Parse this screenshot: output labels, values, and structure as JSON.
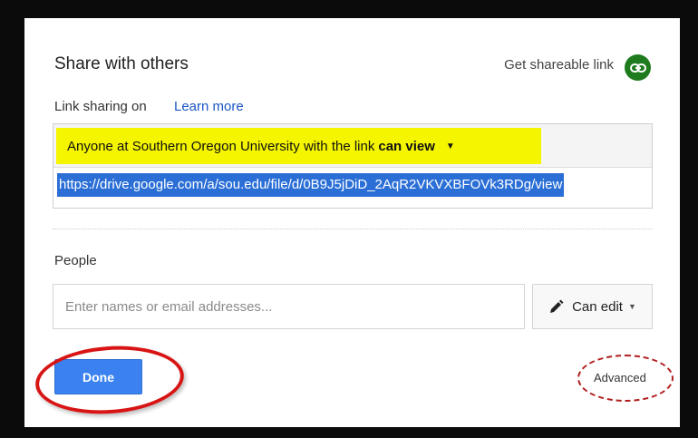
{
  "dialog": {
    "title": "Share with others",
    "get_link_label": "Get shareable link",
    "link_sharing_label": "Link sharing on",
    "learn_more_label": "Learn more",
    "access_text": "Anyone at Southern Oregon University with the link",
    "access_level": "can view",
    "share_url": "https://drive.google.com/a/sou.edu/file/d/0B9J5jDiD_2AqR2VKVXBFOVk3RDg/view",
    "people_label": "People",
    "people_placeholder": "Enter names or email addresses...",
    "permission_label": "Can edit",
    "done_label": "Done",
    "advanced_label": "Advanced"
  },
  "colors": {
    "link_icon": "#1e7b1e",
    "learn_more": "#1a55c5",
    "highlight": "#f5f500",
    "url_selection": "#2b6fd6",
    "done_button": "#3b82f0",
    "annotation_red": "#d81414"
  },
  "icons": {
    "get_link": "link-icon",
    "access_dropdown": "caret-down-icon",
    "permission": "pencil-icon",
    "permission_dropdown": "caret-down-icon"
  }
}
